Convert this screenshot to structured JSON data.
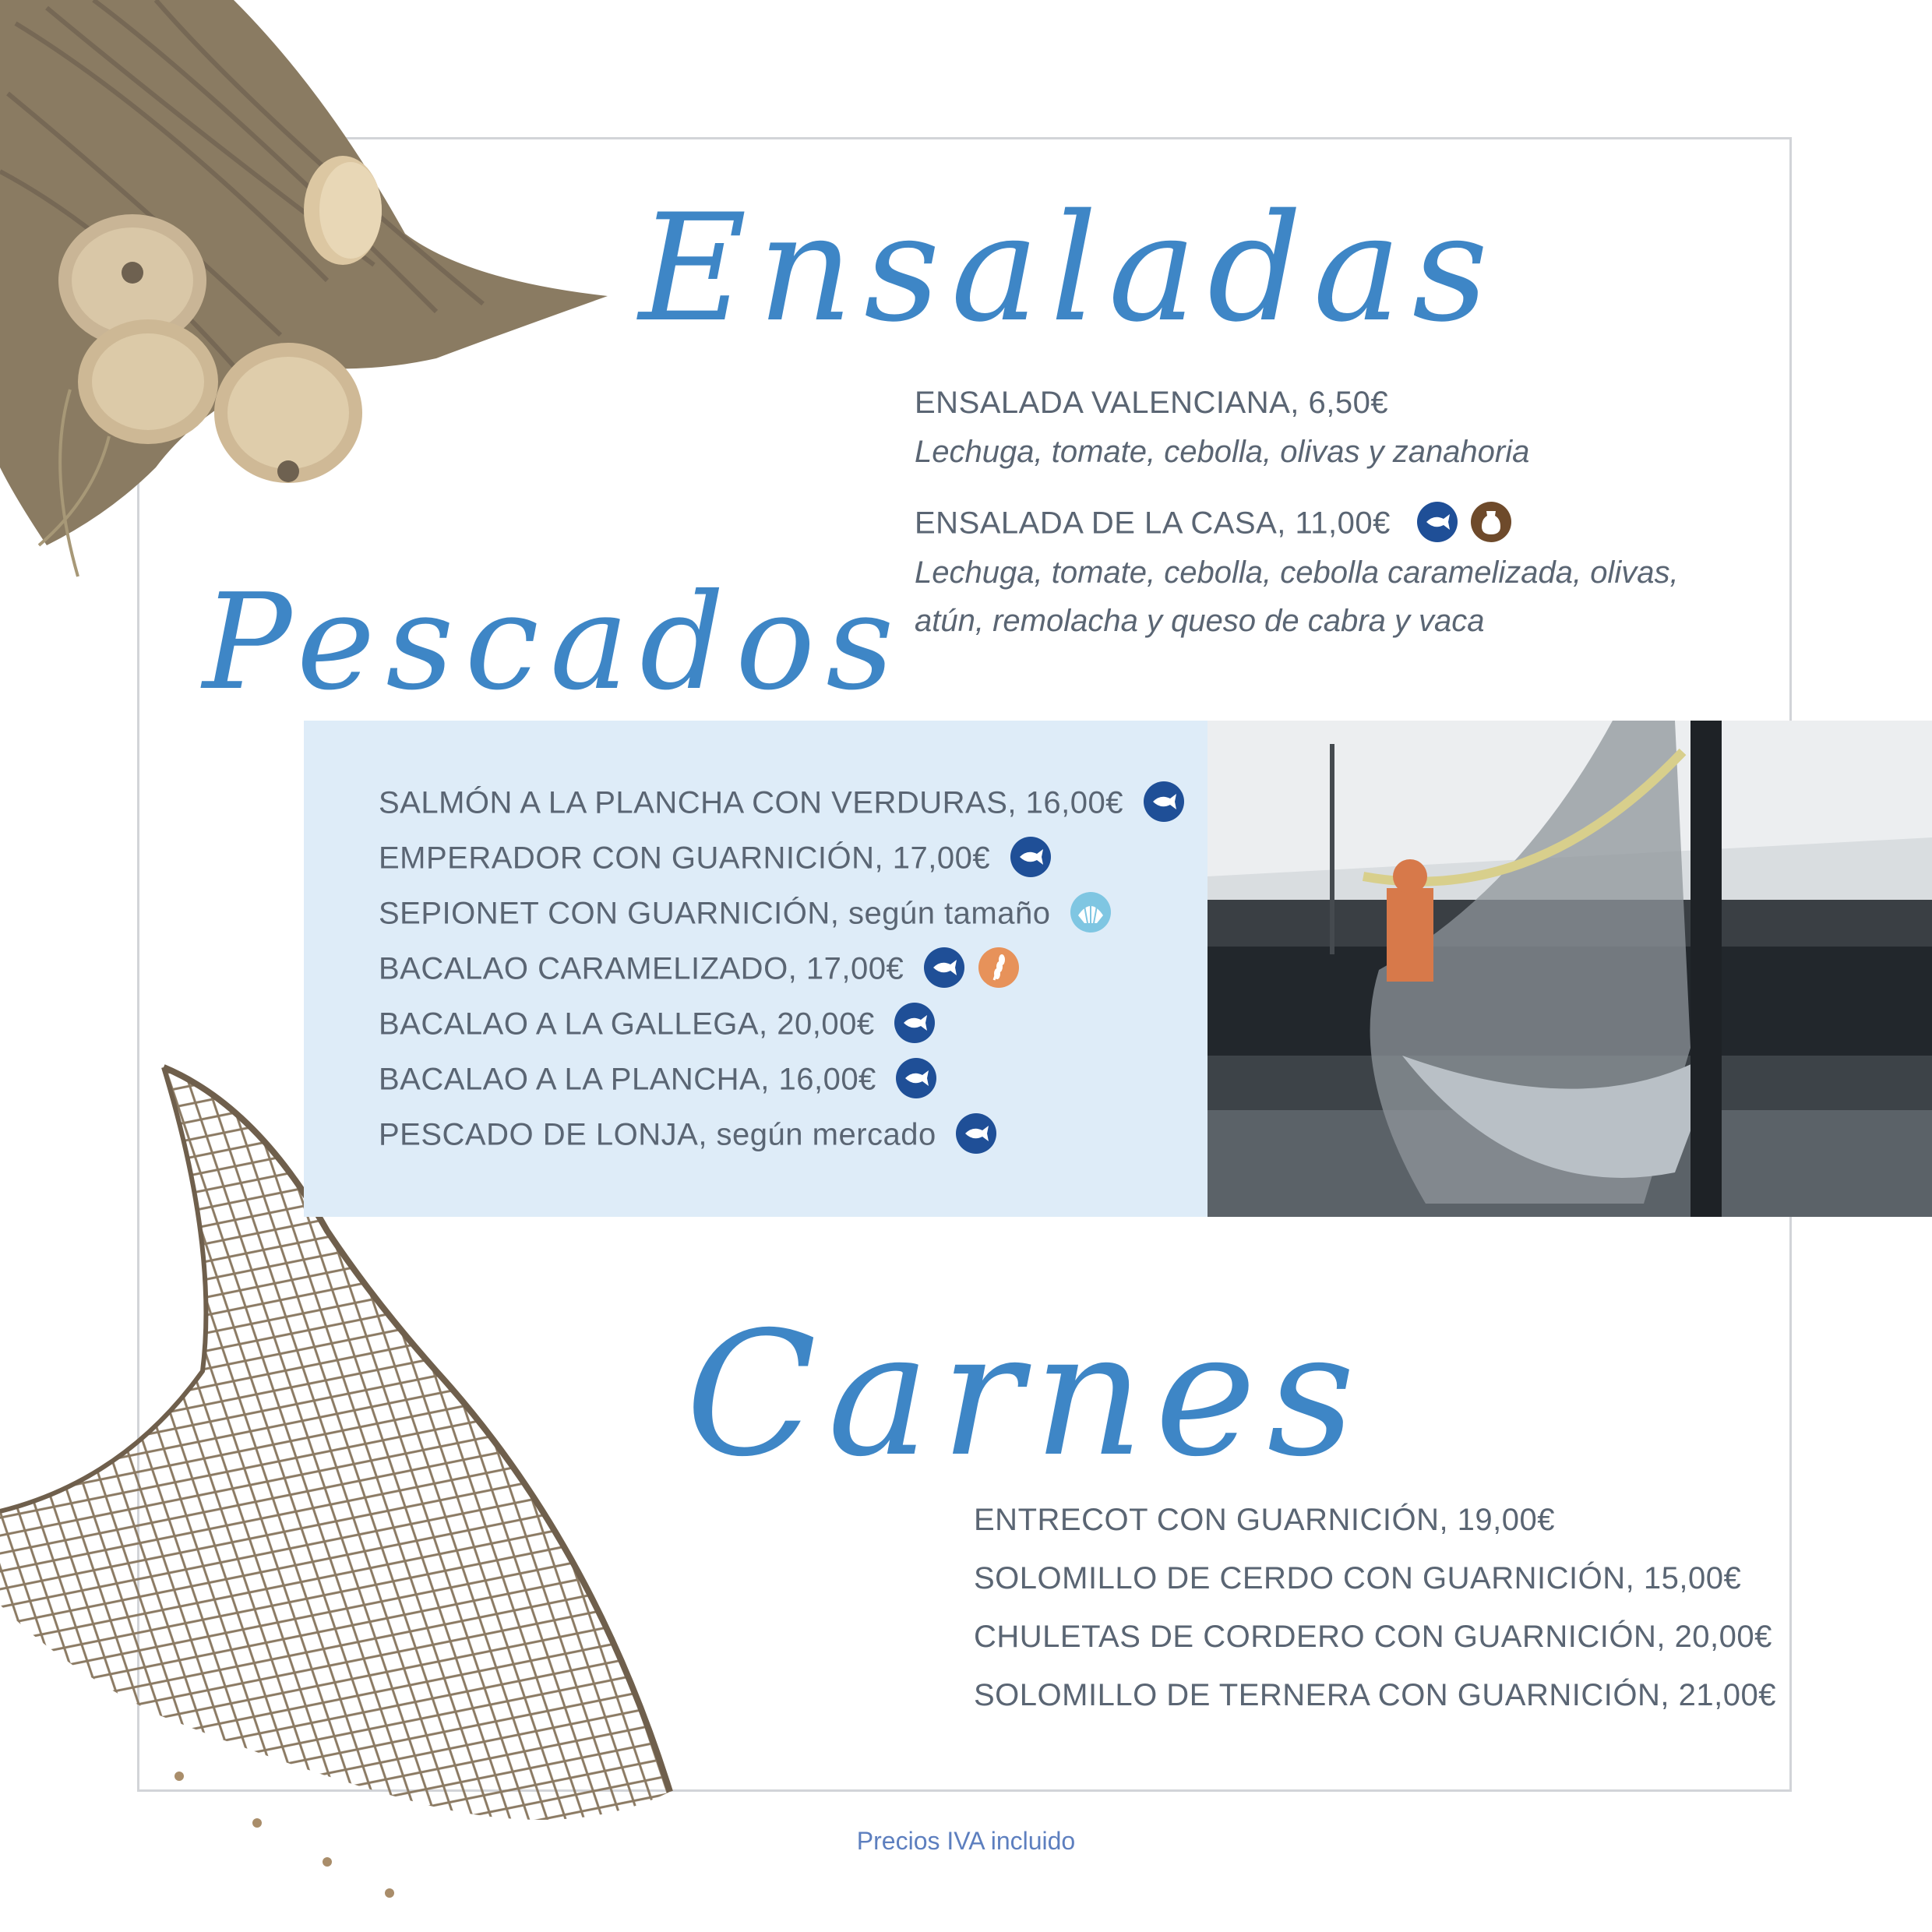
{
  "sections": {
    "ensaladas": {
      "title": "Ensaladas",
      "items": [
        {
          "name": "ENSALADA VALENCIANA,  6,50€",
          "desc_lines": [
            "Lechuga, tomate, cebolla, olivas y zanahoria"
          ]
        },
        {
          "name": "ENSALADA DE LA CASA,  11,00€",
          "desc_lines": [
            "Lechuga, tomate, cebolla, cebolla caramelizada, olivas,",
            "atún, remolacha y queso de cabra y vaca"
          ],
          "allergens": [
            "fish-icon",
            "milk-icon"
          ]
        }
      ]
    },
    "pescados": {
      "title": "Pescados",
      "items": [
        {
          "name": "SALMÓN A LA PLANCHA CON VERDURAS,  16,00€",
          "allergens": [
            "fish-icon"
          ]
        },
        {
          "name": "EMPERADOR CON GUARNICIÓN,  17,00€",
          "allergens": [
            "fish-icon"
          ]
        },
        {
          "name": "SEPIONET CON GUARNICIÓN, según tamaño",
          "allergens": [
            "shell-icon"
          ]
        },
        {
          "name": "BACALAO CARAMELIZADO,  17,00€",
          "allergens": [
            "fish-icon",
            "gluten-icon"
          ]
        },
        {
          "name": "BACALAO A LA GALLEGA,  20,00€",
          "allergens": [
            "fish-icon"
          ]
        },
        {
          "name": "BACALAO A LA PLANCHA, 16,00€",
          "allergens": [
            "fish-icon"
          ]
        },
        {
          "name": "PESCADO DE LONJA,  según mercado",
          "allergens": [
            "fish-icon"
          ]
        }
      ]
    },
    "carnes": {
      "title": "Carnes",
      "items": [
        {
          "name": "ENTRECOT CON GUARNICIÓN,  19,00€"
        },
        {
          "name": "SOLOMILLO DE CERDO CON GUARNICIÓN,  15,00€"
        },
        {
          "name": "CHULETAS DE CORDERO CON GUARNICIÓN,  20,00€"
        },
        {
          "name": "SOLOMILLO DE TERNERA CON GUARNICIÓN,  21,00€"
        }
      ]
    }
  },
  "footer": "Precios IVA incluido",
  "colors": {
    "title": "#3e86c6",
    "text": "#5a6573",
    "band": "#deecf8",
    "fish_badge": "#1f4f97"
  }
}
